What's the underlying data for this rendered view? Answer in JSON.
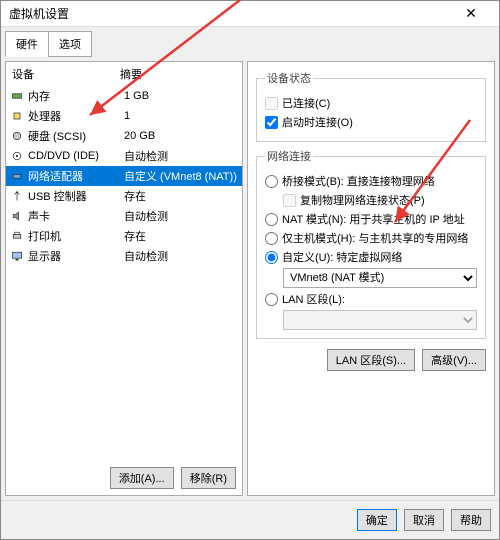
{
  "title": "虚拟机设置",
  "tabs": {
    "hardware": "硬件",
    "options": "选项"
  },
  "hw_header": {
    "device": "设备",
    "summary": "摘要"
  },
  "hw": [
    {
      "icon": "memory",
      "name": "内存",
      "summary": "1 GB"
    },
    {
      "icon": "cpu",
      "name": "处理器",
      "summary": "1"
    },
    {
      "icon": "disk",
      "name": "硬盘 (SCSI)",
      "summary": "20 GB"
    },
    {
      "icon": "cd",
      "name": "CD/DVD (IDE)",
      "summary": "自动检测"
    },
    {
      "icon": "net",
      "name": "网络适配器",
      "summary": "自定义 (VMnet8 (NAT))"
    },
    {
      "icon": "usb",
      "name": "USB 控制器",
      "summary": "存在"
    },
    {
      "icon": "sound",
      "name": "声卡",
      "summary": "自动检测"
    },
    {
      "icon": "printer",
      "name": "打印机",
      "summary": "存在"
    },
    {
      "icon": "display",
      "name": "显示器",
      "summary": "自动检测"
    }
  ],
  "left_btns": {
    "add": "添加(A)...",
    "remove": "移除(R)"
  },
  "device_status": {
    "legend": "设备状态",
    "connected": "已连接(C)",
    "connect_power": "启动时连接(O)"
  },
  "net": {
    "legend": "网络连接",
    "bridged": "桥接模式(B): 直接连接物理网络",
    "replicate": "复制物理网络连接状态(P)",
    "nat": "NAT 模式(N): 用于共享主机的 IP 地址",
    "hostonly": "仅主机模式(H): 与主机共享的专用网络",
    "custom": "自定义(U): 特定虚拟网络",
    "custom_value": "VMnet8 (NAT 模式)",
    "lan": "LAN 区段(L):"
  },
  "adv_btns": {
    "lan": "LAN 区段(S)...",
    "adv": "高级(V)..."
  },
  "footer": {
    "ok": "确定",
    "cancel": "取消",
    "help": "帮助"
  }
}
